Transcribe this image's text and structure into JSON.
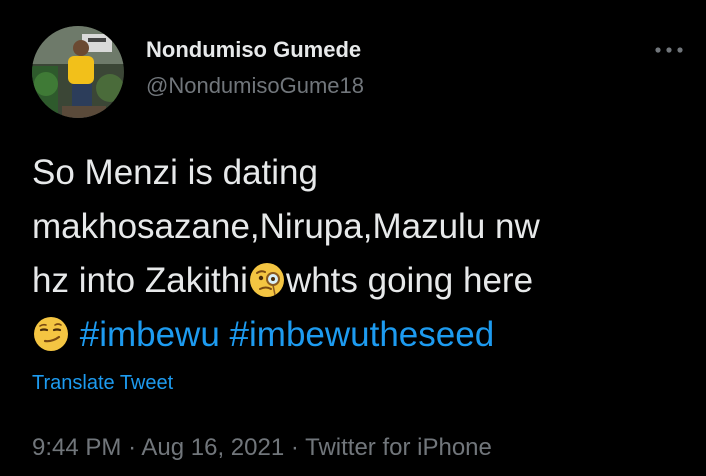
{
  "author": {
    "display_name": "Nondumiso Gumede",
    "handle": "@NondumisoGume18",
    "avatar_icon": "profile-photo"
  },
  "more_icon": "more-options-icon",
  "tweet": {
    "line1": "So Menzi is dating",
    "line2": "makhosazane,Nirupa,Mazulu nw",
    "line3_pre": "hz into Zakithi",
    "line3_emoji": "face-with-monocle",
    "line3_post": "whts going here",
    "line4_emoji": "smirking-face",
    "hashtag1": "#imbewu",
    "hashtag2": "#imbewutheseed"
  },
  "translate_label": "Translate Tweet",
  "meta": {
    "time": "9:44 PM",
    "date": "Aug 16, 2021",
    "source": "Twitter for iPhone",
    "separator": "·"
  },
  "colors": {
    "background": "#000000",
    "text": "#e7e9ea",
    "secondary": "#71767b",
    "link": "#1d9bf0"
  }
}
